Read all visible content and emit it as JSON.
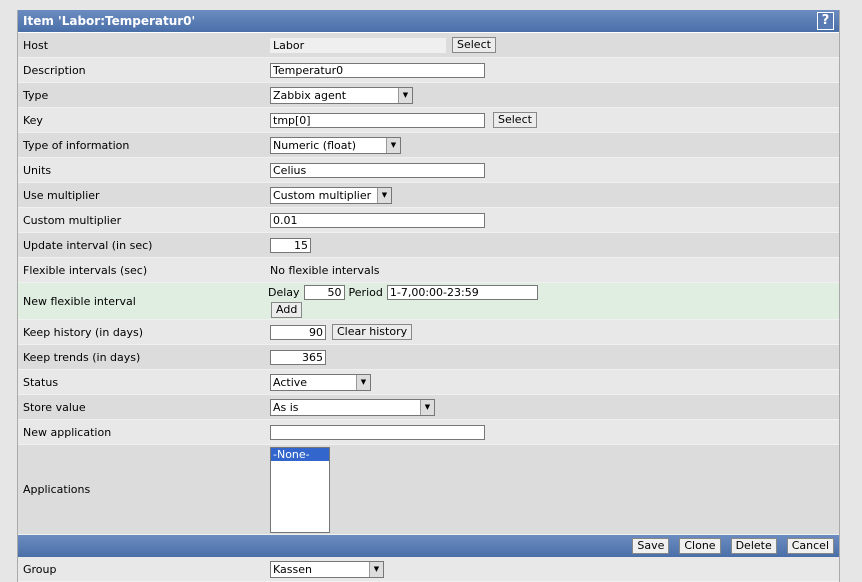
{
  "title": "Item 'Labor:Temperatur0'",
  "help": "?",
  "rows": {
    "host": {
      "label": "Host",
      "value": "Labor",
      "button": "Select"
    },
    "description": {
      "label": "Description",
      "value": "Temperatur0"
    },
    "type": {
      "label": "Type",
      "value": "Zabbix agent"
    },
    "key": {
      "label": "Key",
      "value": "tmp[0]",
      "button": "Select"
    },
    "type_info": {
      "label": "Type of information",
      "value": "Numeric (float)"
    },
    "units": {
      "label": "Units",
      "value": "Celius"
    },
    "use_multiplier": {
      "label": "Use multiplier",
      "value": "Custom multiplier"
    },
    "custom_multiplier": {
      "label": "Custom multiplier",
      "value": "0.01"
    },
    "update_interval": {
      "label": "Update interval (in sec)",
      "value": "15"
    },
    "flexible": {
      "label": "Flexible intervals (sec)",
      "value": "No flexible intervals"
    },
    "new_flexible": {
      "label": "New flexible interval",
      "delay_label": "Delay",
      "delay": "50",
      "period_label": "Period",
      "period": "1-7,00:00-23:59",
      "add": "Add"
    },
    "history": {
      "label": "Keep history (in days)",
      "value": "90",
      "button": "Clear history"
    },
    "trends": {
      "label": "Keep trends (in days)",
      "value": "365"
    },
    "status": {
      "label": "Status",
      "value": "Active"
    },
    "store": {
      "label": "Store value",
      "value": "As is"
    },
    "new_app": {
      "label": "New application",
      "value": ""
    },
    "applications": {
      "label": "Applications",
      "options": [
        "-None-"
      ]
    },
    "group": {
      "label": "Group",
      "value": "Kassen"
    }
  },
  "footer": {
    "save": "Save",
    "clone": "Clone",
    "delete": "Delete",
    "cancel": "Cancel"
  }
}
